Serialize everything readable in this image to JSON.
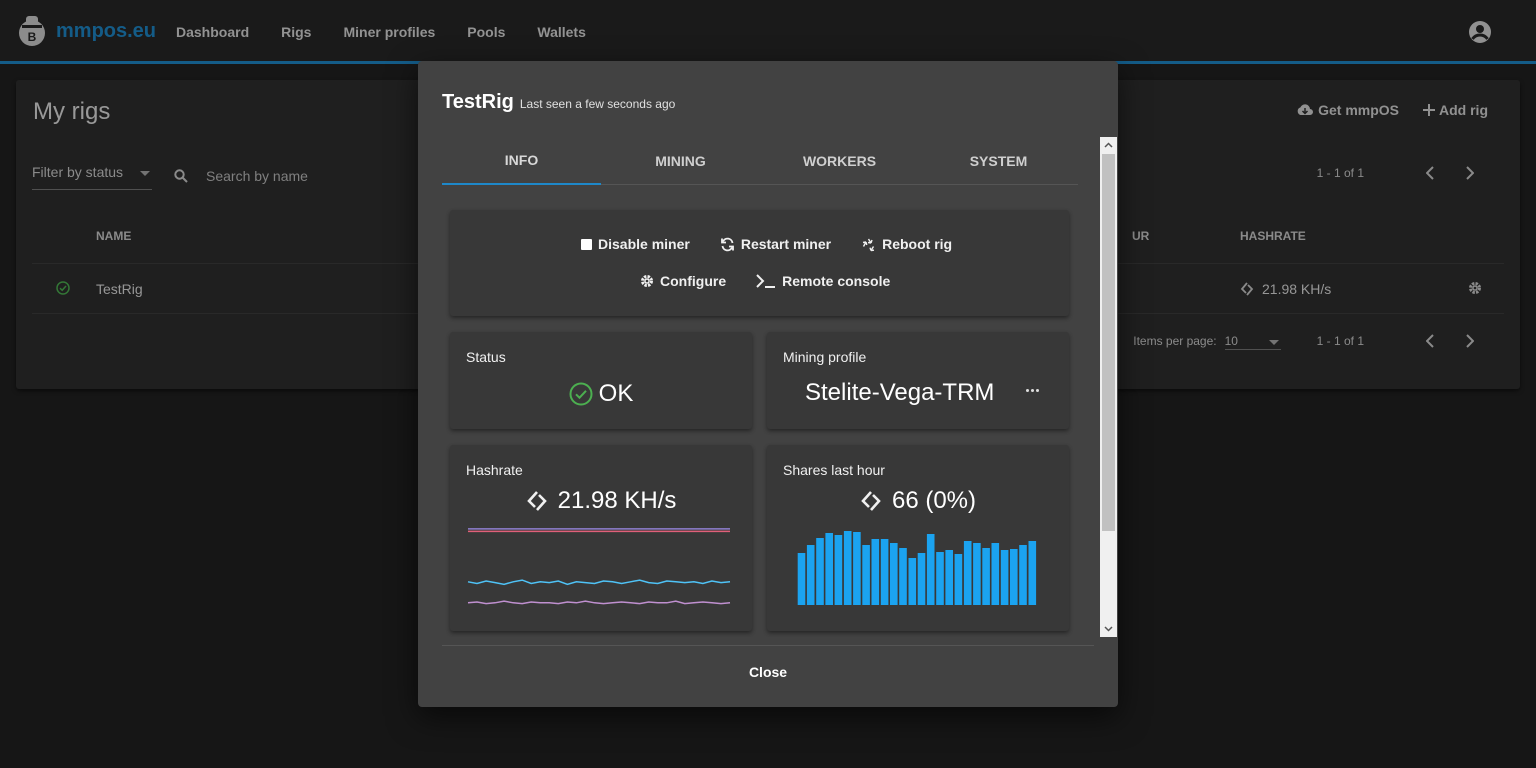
{
  "app": {
    "brand": "mmpos.eu",
    "accent": "#1e88c9"
  },
  "nav": {
    "items": [
      "Dashboard",
      "Rigs",
      "Miner profiles",
      "Pools",
      "Wallets"
    ]
  },
  "page": {
    "title": "My rigs",
    "get_mmpos": "Get mmpOS",
    "add_rig": "Add rig",
    "filter_label": "Filter by status",
    "search_placeholder": "Search by name",
    "range": "1 - 1 of 1",
    "items_per_page_label": "Items per page:",
    "items_per_page": "10",
    "table": {
      "headers": {
        "name": "NAME",
        "ur": "UR",
        "hashrate": "HASHRATE"
      },
      "rows": [
        {
          "name": "TestRig",
          "hashrate": "21.98 KH/s",
          "status_color": "#4caf50"
        }
      ]
    }
  },
  "dialog": {
    "rig_name": "TestRig",
    "last_seen": "Last seen a few seconds ago",
    "tabs": [
      "INFO",
      "MINING",
      "WORKERS",
      "SYSTEM"
    ],
    "active_tab": "INFO",
    "actions": {
      "disable_miner": "Disable miner",
      "restart_miner": "Restart miner",
      "reboot_rig": "Reboot rig",
      "configure": "Configure",
      "remote_console": "Remote console"
    },
    "status": {
      "label": "Status",
      "value": "OK",
      "color": "#4caf50"
    },
    "mining_profile": {
      "label": "Mining profile",
      "value": "Stelite-Vega-TRM"
    },
    "hashrate": {
      "label": "Hashrate",
      "value": "21.98 KH/s"
    },
    "shares": {
      "label": "Shares last hour",
      "value": "66 (0%)"
    },
    "close": "Close"
  },
  "chart_data": [
    {
      "type": "line",
      "title": "",
      "series": [
        {
          "color": "#8f7fd0",
          "values": [
            0.93,
            0.93,
            0.93,
            0.93,
            0.93,
            0.93,
            0.93,
            0.93,
            0.93,
            0.93,
            0.93,
            0.93,
            0.93,
            0.93,
            0.93,
            0.93,
            0.93,
            0.93,
            0.93,
            0.93,
            0.93,
            0.93,
            0.93,
            0.93,
            0.93,
            0.93,
            0.93,
            0.93,
            0.93,
            0.93
          ]
        },
        {
          "color": "#e0607a",
          "values": [
            0.9,
            0.9,
            0.9,
            0.9,
            0.9,
            0.9,
            0.9,
            0.9,
            0.9,
            0.9,
            0.9,
            0.9,
            0.9,
            0.9,
            0.9,
            0.9,
            0.9,
            0.9,
            0.9,
            0.9,
            0.9,
            0.9,
            0.9,
            0.9,
            0.9,
            0.9,
            0.9,
            0.9,
            0.9,
            0.9
          ]
        },
        {
          "color": "#4fc3f7",
          "values": [
            0.3,
            0.28,
            0.31,
            0.29,
            0.27,
            0.3,
            0.32,
            0.28,
            0.3,
            0.29,
            0.31,
            0.27,
            0.3,
            0.29,
            0.28,
            0.31,
            0.3,
            0.28,
            0.3,
            0.32,
            0.29,
            0.28,
            0.31,
            0.3,
            0.29,
            0.3,
            0.28,
            0.31,
            0.29,
            0.3
          ]
        },
        {
          "color": "#c090d0",
          "values": [
            0.05,
            0.06,
            0.04,
            0.05,
            0.07,
            0.05,
            0.04,
            0.06,
            0.05,
            0.05,
            0.04,
            0.06,
            0.05,
            0.07,
            0.05,
            0.04,
            0.05,
            0.06,
            0.05,
            0.04,
            0.06,
            0.05,
            0.05,
            0.07,
            0.04,
            0.05,
            0.06,
            0.05,
            0.04,
            0.05
          ]
        }
      ]
    },
    {
      "type": "bar",
      "title": "",
      "color": "#1ba3f0",
      "values": [
        52,
        60,
        67,
        72,
        70,
        74,
        73,
        60,
        66,
        66,
        62,
        57,
        47,
        52,
        71,
        53,
        55,
        51,
        64,
        62,
        57,
        62,
        55,
        56,
        60,
        64
      ]
    }
  ]
}
